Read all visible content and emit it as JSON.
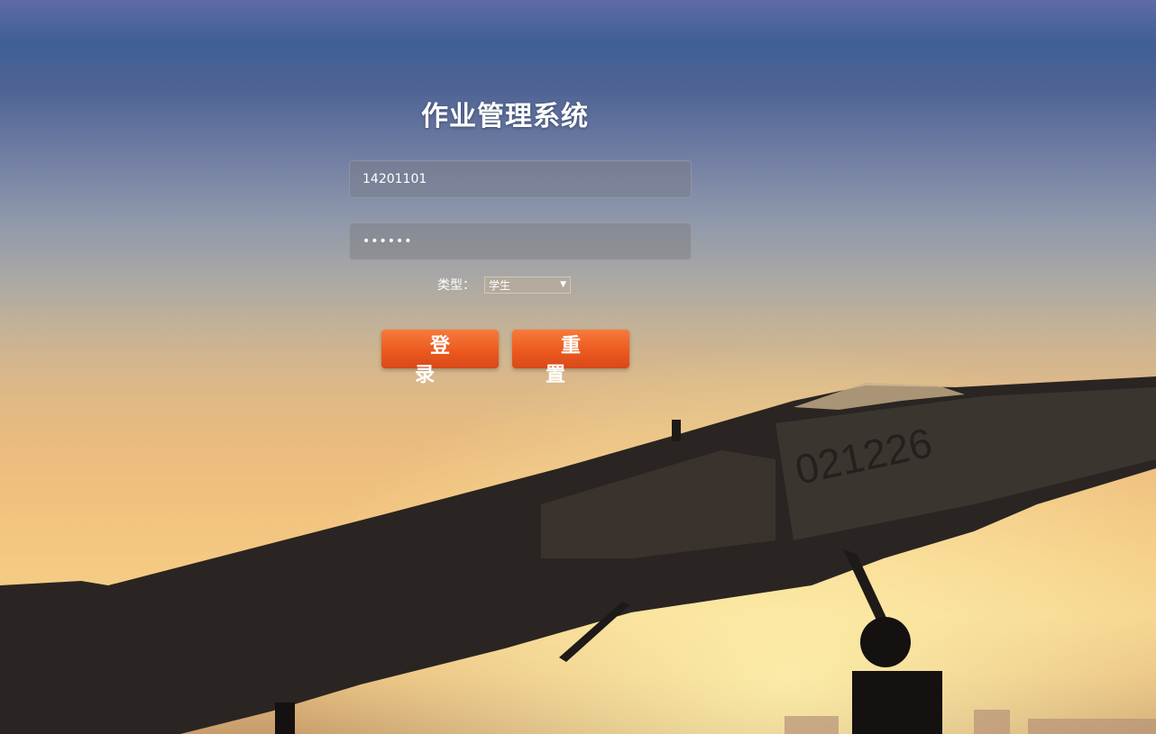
{
  "page": {
    "title": "作业管理系统"
  },
  "form": {
    "username_value": "14201101",
    "password_value": "••••••",
    "type_label": "类型：",
    "type_selected": "学生"
  },
  "buttons": {
    "login_label": "登录",
    "reset_label": "重置"
  },
  "background": {
    "subject": "fighter jet at sunset",
    "tail_number": "021226"
  },
  "colors": {
    "button_accent": "#ec5a1e",
    "title_text": "#ffffff"
  }
}
